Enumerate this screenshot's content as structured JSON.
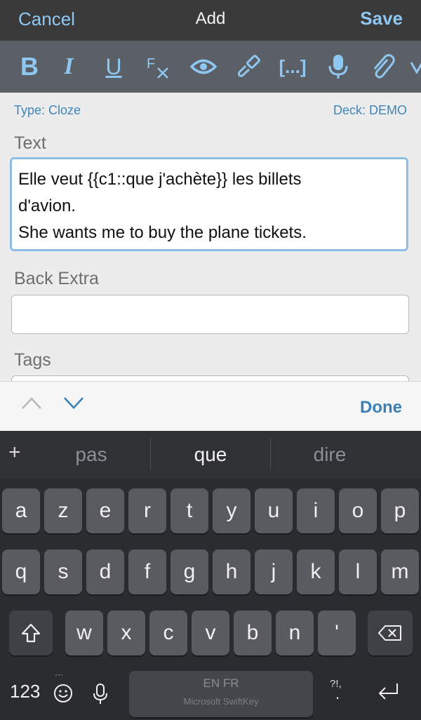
{
  "nav": {
    "cancel": "Cancel",
    "title": "Add",
    "save": "Save"
  },
  "toolbar": {
    "bold": "B",
    "italic": "I",
    "underline": "U",
    "icons": [
      "bold-icon",
      "italic-icon",
      "underline-icon",
      "clear-format-icon",
      "preview-eye-icon",
      "paintbrush-icon",
      "cloze-icon",
      "microphone-icon",
      "paperclip-icon",
      "chevron-more-icon"
    ],
    "cloze": "[...]"
  },
  "note": {
    "type": "Type: Cloze",
    "deck": "Deck: DEMO"
  },
  "fields": {
    "text_label": "Text",
    "text_lines": [
      "Elle veut {{c1::que j'achète}} les billets",
      "d'avion.",
      "She wants me to buy the plane tickets."
    ],
    "back_extra_label": "Back Extra",
    "back_extra_value": "",
    "tags_label": "Tags"
  },
  "accessory": {
    "done": "Done"
  },
  "keyboard": {
    "plus": "+",
    "predictions": [
      "pas",
      "que",
      "dire"
    ],
    "row1": [
      "a",
      "z",
      "e",
      "r",
      "t",
      "y",
      "u",
      "i",
      "o",
      "p"
    ],
    "row2": [
      "q",
      "s",
      "d",
      "f",
      "g",
      "h",
      "j",
      "k",
      "l",
      "m"
    ],
    "row3": [
      "w",
      "x",
      "c",
      "v",
      "b",
      "n",
      "'"
    ],
    "num": "123",
    "space_lang": "EN FR",
    "space_brand": "Microsoft SwiftKey",
    "punct": "?!,",
    "punct_dot": ".",
    "dots": "···",
    "colors": {
      "keyboard_bg": "#2a2c30",
      "key": "#595b60",
      "accent": "#8ec8f2"
    }
  }
}
